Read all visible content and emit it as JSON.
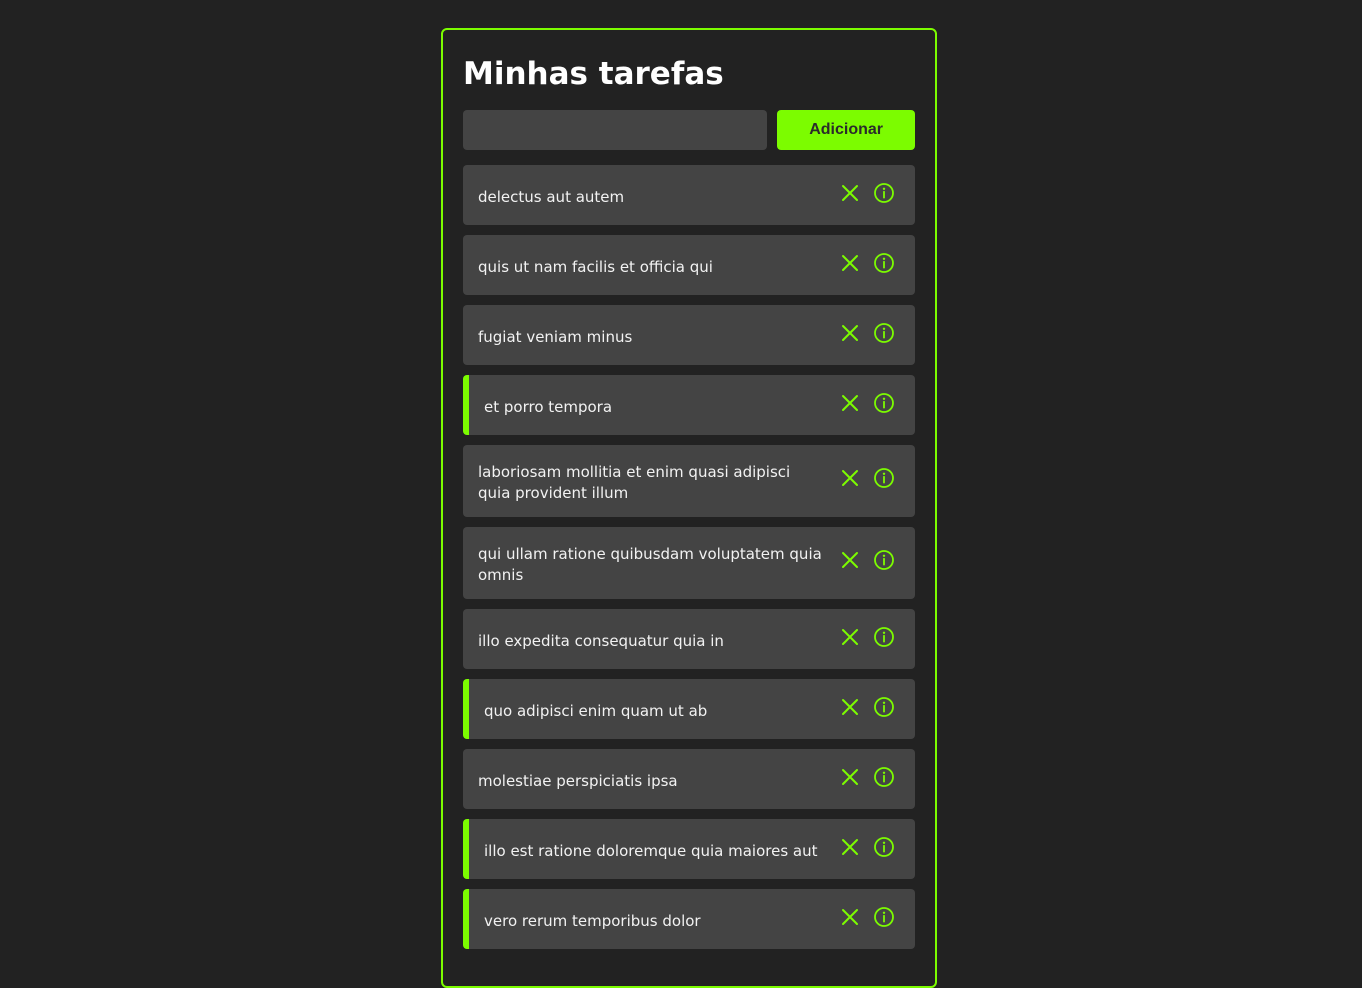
{
  "header": {
    "title": "Minhas tarefas"
  },
  "add_form": {
    "input_value": "",
    "button_label": "Adicionar"
  },
  "colors": {
    "accent": "#7cfc00",
    "background": "#222222",
    "card": "#444444"
  },
  "icons": {
    "remove": "close-icon",
    "details": "info-icon"
  },
  "tasks": [
    {
      "title": "delectus aut autem",
      "completed": false
    },
    {
      "title": "quis ut nam facilis et officia qui",
      "completed": false
    },
    {
      "title": "fugiat veniam minus",
      "completed": false
    },
    {
      "title": "et porro tempora",
      "completed": true
    },
    {
      "title": "laboriosam mollitia et enim quasi adipisci quia provident illum",
      "completed": false
    },
    {
      "title": "qui ullam ratione quibusdam voluptatem quia omnis",
      "completed": false
    },
    {
      "title": "illo expedita consequatur quia in",
      "completed": false
    },
    {
      "title": "quo adipisci enim quam ut ab",
      "completed": true
    },
    {
      "title": "molestiae perspiciatis ipsa",
      "completed": false
    },
    {
      "title": "illo est ratione doloremque quia maiores aut",
      "completed": true
    },
    {
      "title": "vero rerum temporibus dolor",
      "completed": true
    }
  ]
}
